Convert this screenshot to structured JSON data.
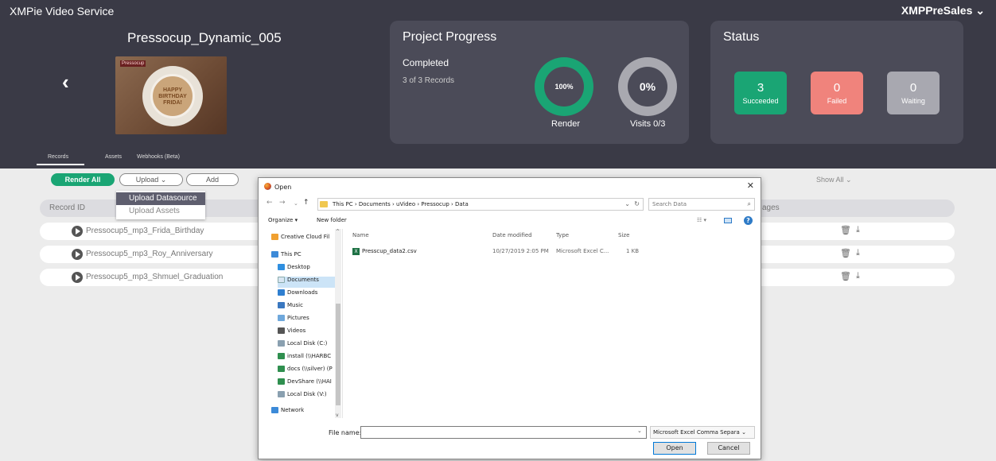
{
  "app": {
    "title": "XMPie Video Service",
    "user": "XMPPreSales"
  },
  "project": {
    "name": "Pressocup_Dynamic_005",
    "thumb_text": "HAPPY BIRTHDAY FRIDA!",
    "thumb_logo": "Pressocup"
  },
  "tabs": [
    "Records",
    "Assets",
    "Webhooks (Beta)"
  ],
  "progress": {
    "title": "Project Progress",
    "state": "Completed",
    "records": "3 of 3 Records",
    "render_value": "100%",
    "render_label": "Render",
    "visits_value": "0%",
    "visits_label": "Visits 0/3"
  },
  "status": {
    "title": "Status",
    "succeeded": {
      "count": "3",
      "label": "Succeeded"
    },
    "failed": {
      "count": "0",
      "label": "Failed"
    },
    "waiting": {
      "count": "0",
      "label": "Waiting"
    }
  },
  "toolbar": {
    "render_all": "Render All",
    "upload": "Upload",
    "add": "Add",
    "show_all": "Show All"
  },
  "upload_menu": [
    "Upload Datasource",
    "Upload Assets"
  ],
  "table": {
    "col_record": "Record ID",
    "col_messages": "ages",
    "rows": [
      "Pressocup5_mp3_Frida_Birthday",
      "Pressocup5_mp3_Roy_Anniversary",
      "Pressocup5_mp3_Shmuel_Graduation"
    ]
  },
  "dialog": {
    "title": "Open",
    "path": "This PC  ›  Documents  ›  uVideo  ›  Pressocup  ›  Data",
    "search_placeholder": "Search Data",
    "organize": "Organize ▾",
    "new_folder": "New folder",
    "nav_items": [
      "Creative Cloud Fil",
      "This PC",
      "Desktop",
      "Documents",
      "Downloads",
      "Music",
      "Pictures",
      "Videos",
      "Local Disk (C:)",
      "install (\\\\HARBC",
      "docs (\\\\silver) (P",
      "DevShare (\\\\HAI",
      "Local Disk (V:)",
      "Network"
    ],
    "columns": {
      "name": "Name",
      "date": "Date modified",
      "type": "Type",
      "size": "Size"
    },
    "file": {
      "name": "Presscup_data2.csv",
      "date": "10/27/2019 2:05 PM",
      "type": "Microsoft Excel C...",
      "size": "1 KB"
    },
    "file_name_label": "File name:",
    "file_name_value": "",
    "file_type": "Microsoft Excel Comma Separa",
    "open": "Open",
    "cancel": "Cancel"
  },
  "colors": {
    "header": "#3a3a46",
    "card": "#4b4b58",
    "green": "#1aa574",
    "red": "#f0837c",
    "grey": "#a8a8b0"
  }
}
